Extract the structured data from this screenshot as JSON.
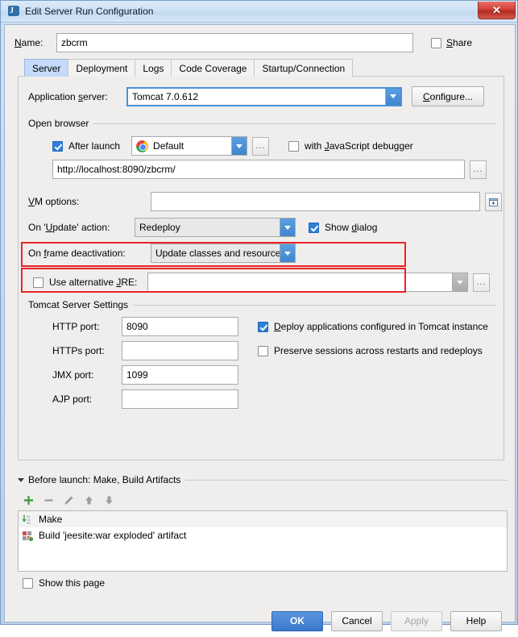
{
  "window": {
    "title": "Edit Server Run Configuration",
    "app_icon": "intellij-idea-icon",
    "close_label": "✕"
  },
  "name_row": {
    "label": "Name:",
    "value": "zbcrm",
    "share_label": "Share",
    "share_checked": false
  },
  "tabs": [
    {
      "label": "Server",
      "active": true
    },
    {
      "label": "Deployment",
      "active": false
    },
    {
      "label": "Logs",
      "active": false
    },
    {
      "label": "Code Coverage",
      "active": false
    },
    {
      "label": "Startup/Connection",
      "active": false
    }
  ],
  "server_tab": {
    "application_server": {
      "label": "Application server:",
      "value": "Tomcat 7.0.612",
      "configure_label": "Configure..."
    },
    "open_browser": {
      "caption": "Open browser",
      "after_launch_label": "After launch",
      "after_launch_checked": true,
      "browser_value": "Default",
      "browser_icon": "chrome-icon",
      "browse_button_label": "...",
      "js_debugger_label": "with JavaScript debugger",
      "js_debugger_checked": false,
      "url_value": "http://localhost:8090/zbcrm/",
      "url_browse_label": "..."
    },
    "vm_options": {
      "label": "VM options:",
      "value": "",
      "expand_icon": "expand-editor-icon"
    },
    "on_update_action": {
      "label": "On 'Update' action:",
      "value": "Redeploy",
      "show_dialog_label": "Show dialog",
      "show_dialog_checked": true
    },
    "on_frame_deactivation": {
      "label": "On frame deactivation:",
      "value": "Update classes and resources"
    },
    "alternative_jre": {
      "label": "Use alternative JRE:",
      "checked": false,
      "value": "",
      "browse_label": "..."
    },
    "tomcat_settings": {
      "caption": "Tomcat Server Settings",
      "http_port_label": "HTTP port:",
      "http_port_value": "8090",
      "https_port_label": "HTTPs port:",
      "https_port_value": "",
      "jmx_port_label": "JMX port:",
      "jmx_port_value": "1099",
      "ajp_port_label": "AJP port:",
      "ajp_port_value": "",
      "deploy_apps_label": "Deploy applications configured in Tomcat instance",
      "deploy_apps_checked": true,
      "preserve_sessions_label": "Preserve sessions across restarts and redeploys",
      "preserve_sessions_checked": false
    }
  },
  "before_launch": {
    "header": "Before launch: Make, Build Artifacts",
    "toolbar": [
      {
        "name": "add-icon",
        "glyph": "+"
      },
      {
        "name": "remove-icon",
        "glyph": "−"
      },
      {
        "name": "edit-pencil-icon",
        "glyph": "✎"
      },
      {
        "name": "move-up-icon",
        "glyph": "↑"
      },
      {
        "name": "move-down-icon",
        "glyph": "↓"
      }
    ],
    "items": [
      {
        "label": "Make",
        "icon": "make-icon",
        "selected": true
      },
      {
        "label": "Build 'jeesite:war exploded' artifact",
        "icon": "artifact-icon",
        "selected": false
      }
    ]
  },
  "show_this_page": {
    "label": "Show this page",
    "checked": false
  },
  "footer_buttons": [
    {
      "label": "OK",
      "style": "primary",
      "enabled": true
    },
    {
      "label": "Cancel",
      "style": "normal",
      "enabled": true
    },
    {
      "label": "Apply",
      "style": "disabled",
      "enabled": false
    },
    {
      "label": "Help",
      "style": "normal",
      "enabled": true
    }
  ],
  "annotations": {
    "accent_color": "#e8242a",
    "highlighted_rows": [
      "On 'Update' action:",
      "On frame deactivation:"
    ]
  }
}
